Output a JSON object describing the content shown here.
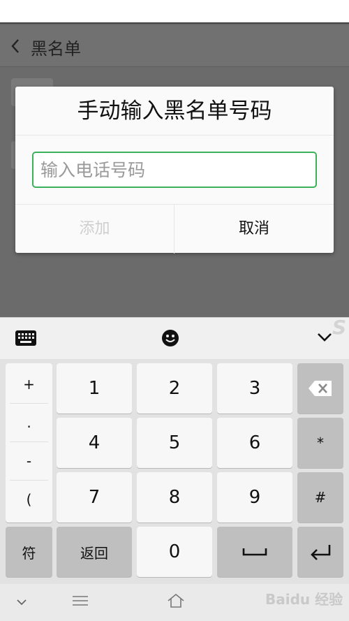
{
  "app": {
    "title": "黑名单"
  },
  "dialog": {
    "title": "手动输入黑名单号码",
    "input": {
      "value": "",
      "placeholder": "输入电话号码"
    },
    "add_button": "添加",
    "cancel_button": "取消"
  },
  "keyboard": {
    "symbols": [
      "+",
      ".",
      "-",
      "("
    ],
    "digits": [
      "1",
      "2",
      "3",
      "4",
      "5",
      "6",
      "7",
      "8",
      "9",
      "0"
    ],
    "star": "*",
    "hash": "#",
    "symbol_key": "符",
    "back_key": "返回"
  },
  "watermark": {
    "text": "Baidu 经验"
  },
  "colors": {
    "accent_green": "#3cb15a",
    "disabled_text": "#cfcfcf",
    "overlay": "#6b6b6b"
  }
}
